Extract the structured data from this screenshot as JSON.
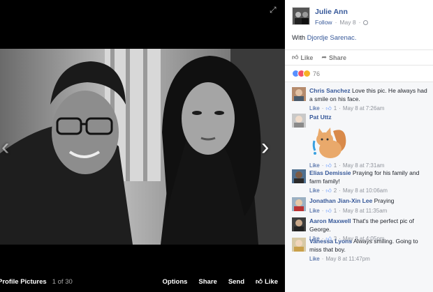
{
  "viewer": {
    "album_name": "Profile Pictures",
    "album_count": "1 of 30",
    "options_label": "Options",
    "share_label": "Share",
    "send_label": "Send",
    "like_label": "Like"
  },
  "post": {
    "author": "Julie Ann",
    "follow_label": "Follow",
    "date": "May 8",
    "text_prefix": "With",
    "tagged": "Djordje Sarenac.",
    "like_label": "Like",
    "share_label": "Share",
    "reaction_count": "76",
    "colors": {
      "link": "#365899",
      "like": "#5890ff",
      "love": "#f25268",
      "wow": "#f7b125"
    }
  },
  "comments": [
    {
      "name": "Chris Sanchez",
      "text": "Love this pic. He always had a smile on his face.",
      "like": "Like",
      "likes": "1",
      "time": "May 8 at 7:26am"
    },
    {
      "name": "Pat Uttz",
      "text": "",
      "like": "Like",
      "likes": "1",
      "time": "May 8 at 7:31am",
      "sticker": "sad-cat-sticker"
    },
    {
      "name": "Elias Demissie",
      "text": "Praying for his family and farm family!",
      "like": "Like",
      "likes": "2",
      "time": "May 8 at 10:06am"
    },
    {
      "name": "Jonathan Jian-Xin Lee",
      "text": "Praying",
      "like": "Like",
      "likes": "1",
      "time": "May 8 at 11:35am"
    },
    {
      "name": "Aaron Maxwell",
      "text": "That's the perfect pic of George.",
      "like": "Like",
      "likes": "3",
      "time": "May 8 at 4:05pm"
    },
    {
      "name": "Vanessa Lyons",
      "text": "Always smiling. Going to miss that boy.",
      "like": "Like",
      "likes": "",
      "time": "May 8 at 11:47pm"
    }
  ]
}
